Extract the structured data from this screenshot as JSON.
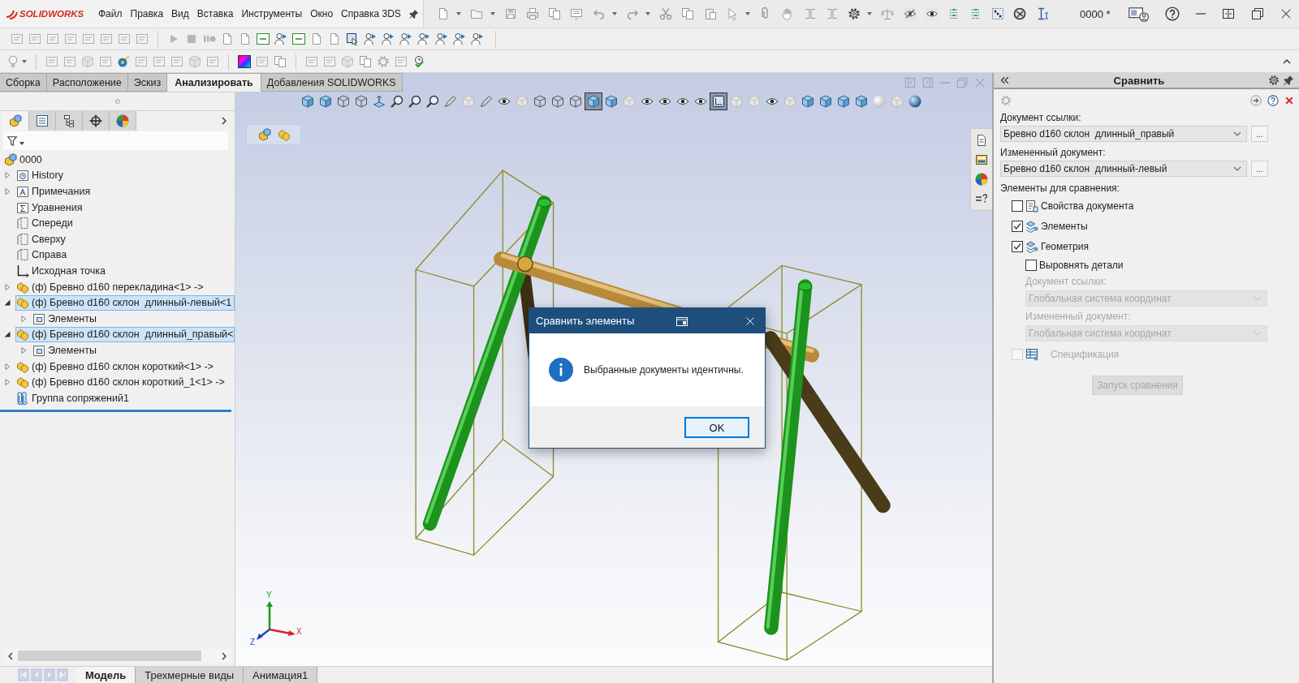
{
  "title_bar": {
    "logo": "SOLIDWORKS",
    "document_title": "0000 *"
  },
  "menu": [
    "Файл",
    "Правка",
    "Вид",
    "Вставка",
    "Инструменты",
    "Окно",
    "Справка 3DS"
  ],
  "command_tabs": [
    {
      "label": "Сборка",
      "selected": false
    },
    {
      "label": "Расположение",
      "selected": false
    },
    {
      "label": "Эскиз",
      "selected": false
    },
    {
      "label": "Анализировать",
      "selected": true
    },
    {
      "label": "Добавления SOLIDWORKS",
      "selected": false
    }
  ],
  "feature_manager": {
    "tabs": [
      {
        "selected": true
      },
      {
        "selected": false
      },
      {
        "selected": false
      },
      {
        "selected": false
      },
      {
        "selected": false
      }
    ],
    "root": {
      "label": "0000"
    },
    "items": [
      {
        "kind": "history",
        "label": "History",
        "expandable": true,
        "expanded": false,
        "selected": false
      },
      {
        "kind": "annotations",
        "label": "Примечания",
        "expandable": true,
        "expanded": false,
        "selected": false
      },
      {
        "kind": "equations",
        "label": "Уравнения",
        "expandable": false,
        "selected": false
      },
      {
        "kind": "plane",
        "label": "Спереди",
        "expandable": false,
        "selected": false
      },
      {
        "kind": "plane",
        "label": "Сверху",
        "expandable": false,
        "selected": false
      },
      {
        "kind": "plane",
        "label": "Справа",
        "expandable": false,
        "selected": false
      },
      {
        "kind": "origin",
        "label": "Исходная точка",
        "expandable": false,
        "selected": false
      },
      {
        "kind": "component",
        "label": "(ф) Бревно d160 перекладина<1> ->",
        "expandable": true,
        "expanded": false,
        "selected": false
      },
      {
        "kind": "component",
        "label": "(ф) Бревно d160 склон  длинный-левый<1",
        "expandable": true,
        "expanded": true,
        "selected": true,
        "children": [
          {
            "kind": "features",
            "label": "Элементы",
            "expandable": true,
            "expanded": false,
            "selected": false
          }
        ]
      },
      {
        "kind": "component",
        "label": "(ф) Бревно d160 склон  длинный_правый<",
        "expandable": true,
        "expanded": true,
        "selected": true,
        "children": [
          {
            "kind": "features",
            "label": "Элементы",
            "expandable": true,
            "expanded": false,
            "selected": false
          }
        ]
      },
      {
        "kind": "component",
        "label": "(ф) Бревно d160 склон короткий<1> ->",
        "expandable": true,
        "expanded": false,
        "selected": false
      },
      {
        "kind": "component",
        "label": "(ф) Бревно d160 склон короткий_1<1> ->",
        "expandable": true,
        "expanded": false,
        "selected": false
      },
      {
        "kind": "mates",
        "label": "Группа сопряжений1",
        "expandable": false,
        "selected": false
      }
    ]
  },
  "viewport": {
    "view_toolbar": [
      {
        "selected": false
      },
      {
        "selected": false
      },
      {
        "selected": false
      },
      {
        "selected": false
      },
      {
        "selected": false
      },
      {
        "selected": false
      },
      {
        "selected": false
      },
      {
        "selected": false
      },
      {
        "selected": false
      },
      {
        "selected": false
      },
      {
        "selected": false
      },
      {
        "selected": false
      },
      {
        "selected": false
      },
      {
        "selected": false
      },
      {
        "selected": false
      },
      {
        "selected": false
      },
      {
        "selected": true
      },
      {
        "selected": false
      },
      {
        "selected": false
      },
      {
        "selected": false
      },
      {
        "selected": false
      },
      {
        "selected": false
      },
      {
        "selected": false
      },
      {
        "selected": true
      },
      {
        "selected": false
      },
      {
        "selected": false
      },
      {
        "selected": false
      },
      {
        "selected": false
      },
      {
        "selected": false
      },
      {
        "selected": false
      },
      {
        "selected": false
      },
      {
        "selected": false
      },
      {
        "selected": false
      },
      {
        "selected": false
      },
      {
        "selected": false
      }
    ],
    "triad": {
      "x": "X",
      "y": "Y",
      "z": "Z"
    }
  },
  "dialog": {
    "title": "Сравнить элементы",
    "message": "Выбранные документы идентичны.",
    "button": "OK"
  },
  "compare_panel": {
    "title": "Сравнить",
    "fields": [
      {
        "label": "Документ ссылки:",
        "value": "Бревно d160 склон  длинный_правый",
        "browse": "..."
      },
      {
        "label": "Измененный документ:",
        "value": "Бревно d160 склон  длинный-левый",
        "browse": "..."
      }
    ],
    "section_label": "Элементы для сравнения:",
    "options": [
      {
        "kind": "checkbox",
        "label": "Свойства документа",
        "checked": false,
        "disabled": false
      },
      {
        "kind": "checkbox",
        "label": "Элементы",
        "checked": true,
        "disabled": false
      },
      {
        "kind": "checkbox",
        "label": "Геометрия",
        "checked": true,
        "disabled": false
      },
      {
        "kind": "sub_checkbox",
        "label": "Выровнять детали",
        "checked": false,
        "disabled": false
      },
      {
        "kind": "sub_select",
        "label": "Документ ссылки:",
        "value": "Глобальная система координат",
        "disabled": true
      },
      {
        "kind": "sub_select",
        "label": "Измененный документ:",
        "value": "Глобальная система координат",
        "disabled": true
      },
      {
        "kind": "checkbox",
        "label": "Спецификация",
        "checked": false,
        "disabled": true
      }
    ],
    "run_button": {
      "label": "Запуск сравнения",
      "disabled": true
    }
  },
  "bottom_tabs": [
    {
      "label": "Модель",
      "selected": true
    },
    {
      "label": "Трехмерные виды",
      "selected": false
    },
    {
      "label": "Анимация1",
      "selected": false
    }
  ]
}
